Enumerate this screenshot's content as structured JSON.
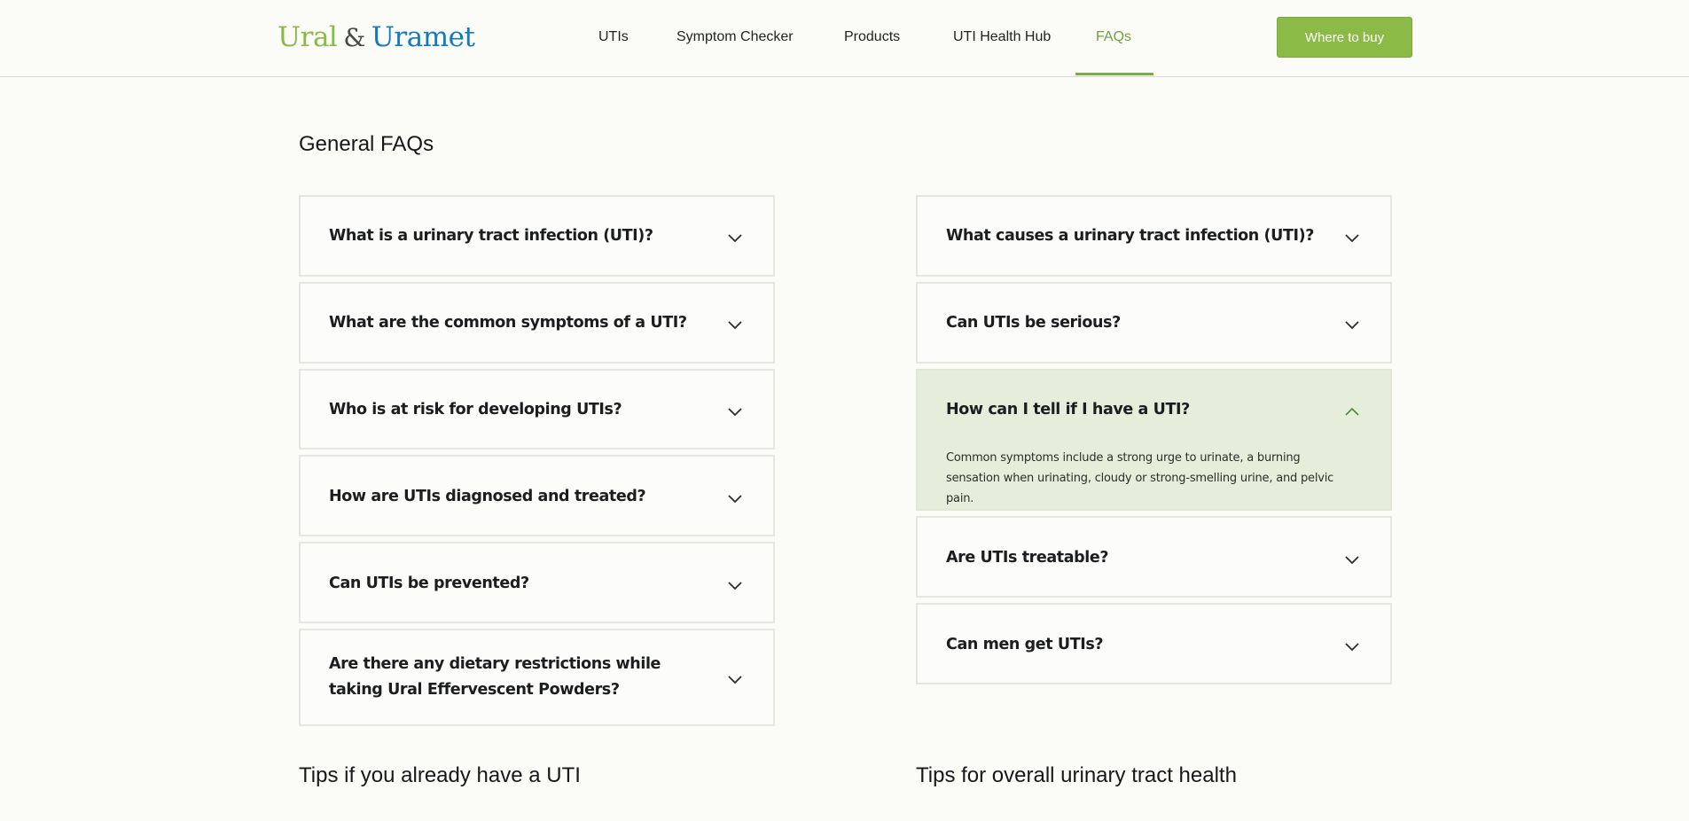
{
  "header": {
    "logo": {
      "part1": "Ural",
      "amp": "&",
      "part2": "Uramet"
    },
    "nav": [
      {
        "label": "UTIs",
        "active": false
      },
      {
        "label": "Symptom Checker",
        "active": false
      },
      {
        "label": "Products",
        "active": false
      },
      {
        "label": "UTI Health Hub",
        "active": false
      },
      {
        "label": "FAQs",
        "active": true
      }
    ],
    "cta_label": "Where to buy"
  },
  "general_faqs": {
    "title": "General FAQs",
    "left": [
      {
        "question": "What is a urinary tract infection (UTI)?",
        "expanded": false
      },
      {
        "question": "What are the common symptoms of a UTI?",
        "expanded": false
      },
      {
        "question": "Who is at risk for developing UTIs?",
        "expanded": false
      },
      {
        "question": "How are UTIs diagnosed and treated?",
        "expanded": false
      },
      {
        "question": "Can UTIs be prevented?",
        "expanded": false
      },
      {
        "question": "Are there any dietary restrictions while taking Ural Effervescent Powders?",
        "expanded": false
      }
    ],
    "right": [
      {
        "question": "What causes a urinary tract infection (UTI)?",
        "expanded": false
      },
      {
        "question": "Can UTIs be serious?",
        "expanded": false
      },
      {
        "question": "How can I tell if I have a UTI?",
        "expanded": true,
        "answer": "Common symptoms include a strong urge to urinate, a burning sensation when urinating, cloudy or strong-smelling urine, and pelvic pain."
      },
      {
        "question": "Are UTIs treatable?",
        "expanded": false
      },
      {
        "question": "Can men get UTIs?",
        "expanded": false
      }
    ]
  },
  "tips": {
    "left_title": "Tips if you already have a UTI",
    "right_title": "Tips for overall urinary tract health"
  },
  "icons": {
    "collapsed": "chevron-down-icon",
    "expanded": "chevron-up-icon"
  },
  "colors": {
    "brand_green": "#8bbb46",
    "brand_blue": "#1579bf",
    "active_nav": "#6f9e3b",
    "expanded_card": "#e6eddb",
    "page_background": "#fbfcf8"
  }
}
